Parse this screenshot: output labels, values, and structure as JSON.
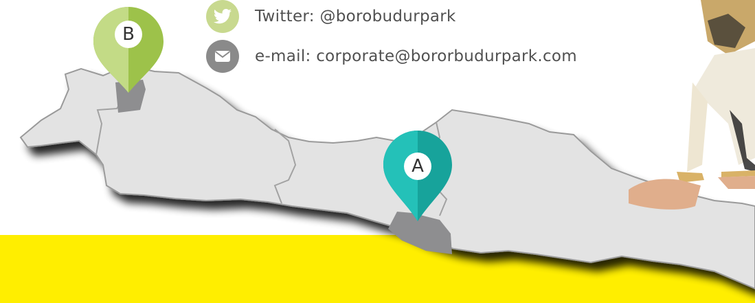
{
  "contacts": {
    "twitter": {
      "text": "Twitter: @borobudurpark",
      "icon": "twitter-bird-icon",
      "icon_color": "#c8d98f"
    },
    "email": {
      "text": "e-mail: corporate@bororbudurpark.com",
      "icon": "envelope-icon",
      "icon_color": "#8a8a8a"
    }
  },
  "map": {
    "land_color": "#e3e3e3",
    "border_color": "#9a9a9a",
    "highlight_color": "#8e8e90",
    "markers": {
      "a": {
        "letter": "A",
        "color": "#1fbab1",
        "color_shade": "#17a39b"
      },
      "b": {
        "letter": "B",
        "color": "#b5d46d",
        "color_shade": "#9dc24a"
      }
    }
  },
  "banner": {
    "color": "#ffee00"
  },
  "illustration": {
    "subject": "dancer-feet-illustration"
  }
}
